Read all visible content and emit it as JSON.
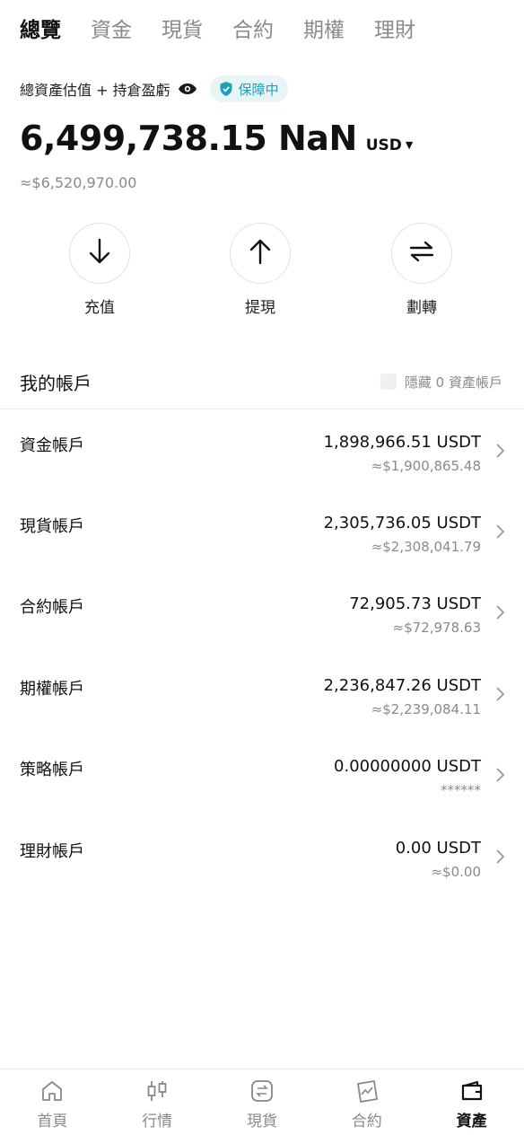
{
  "tabs": [
    {
      "label": "總覽",
      "active": true
    },
    {
      "label": "資金"
    },
    {
      "label": "現貨"
    },
    {
      "label": "合約"
    },
    {
      "label": "期權"
    },
    {
      "label": "理財"
    }
  ],
  "summary": {
    "label": "總資產估值 + 持倉盈虧",
    "badge": "保障中",
    "total": "6,499,738.15 NaN",
    "currency": "USD",
    "approx": "≈$6,520,970.00"
  },
  "actions": [
    {
      "label": "充值",
      "icon": "arrow-down-icon"
    },
    {
      "label": "提現",
      "icon": "arrow-up-icon"
    },
    {
      "label": "劃轉",
      "icon": "transfer-icon"
    }
  ],
  "accounts_header": {
    "title": "我的帳戶",
    "hide_zero": "隱藏 0 資產帳戶"
  },
  "accounts": [
    {
      "name": "資金帳戶",
      "amount": "1,898,966.51 USDT",
      "usd": "≈$1,900,865.48"
    },
    {
      "name": "現貨帳戶",
      "amount": "2,305,736.05 USDT",
      "usd": "≈$2,308,041.79"
    },
    {
      "name": "合約帳戶",
      "amount": "72,905.73 USDT",
      "usd": "≈$72,978.63"
    },
    {
      "name": "期權帳戶",
      "amount": "2,236,847.26 USDT",
      "usd": "≈$2,239,084.11"
    },
    {
      "name": "策略帳戶",
      "amount": "0.00000000 USDT",
      "usd": "******"
    },
    {
      "name": "理財帳戶",
      "amount": "0.00 USDT",
      "usd": "≈$0.00"
    }
  ],
  "bottom_nav": [
    {
      "label": "首頁",
      "icon": "home-icon"
    },
    {
      "label": "行情",
      "icon": "candlestick-icon"
    },
    {
      "label": "現貨",
      "icon": "swap-icon"
    },
    {
      "label": "合約",
      "icon": "contract-chart-icon"
    },
    {
      "label": "資產",
      "icon": "wallet-icon",
      "active": true
    }
  ],
  "colors": {
    "accent": "#1fa0b8",
    "badge_bg": "#e8f4f6",
    "muted": "#8a8a8a"
  }
}
